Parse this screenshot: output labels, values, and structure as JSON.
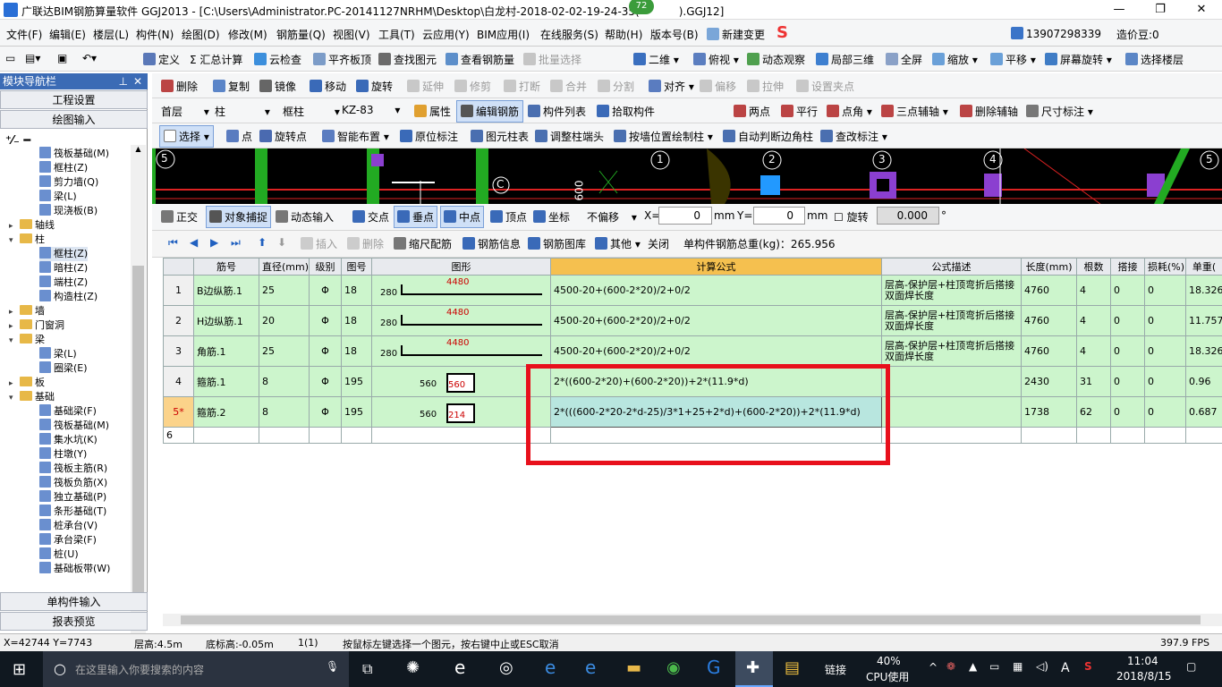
{
  "window": {
    "title": "广联达BIM钢筋算量软件 GGJ2013 - [C:\\Users\\Administrator.PC-20141127NRHM\\Desktop\\白龙村-2018-02-02-19-24-35(",
    "title_tail": ").GGJ12]",
    "badge": "72",
    "min": "—",
    "max": "❐",
    "close": "✕"
  },
  "menu": [
    "文件(F)",
    "编辑(E)",
    "楼层(L)",
    "构件(N)",
    "绘图(D)",
    "修改(M)",
    "钢筋量(Q)",
    "视图(V)",
    "工具(T)",
    "云应用(Y)",
    "BIM应用(I)",
    "在线服务(S)",
    "帮助(H)",
    "版本号(B)",
    "新建变更",
    "13907298339",
    "造价豆:0"
  ],
  "toolbar1": [
    "定义",
    "Σ 汇总计算",
    "云检查",
    "平齐板顶",
    "查找图元",
    "查看钢筋量",
    "批量选择",
    "二维",
    "俯视",
    "动态观察",
    "局部三维",
    "全屏",
    "缩放",
    "平移",
    "屏幕旋转",
    "选择楼层"
  ],
  "toolbar2": [
    "删除",
    "复制",
    "镜像",
    "移动",
    "旋转",
    "延伸",
    "修剪",
    "打断",
    "合并",
    "分割",
    "对齐",
    "偏移",
    "拉伸",
    "设置夹点"
  ],
  "toolbar3": {
    "floor": "首层",
    "type": "柱",
    "subtype": "框柱",
    "name": "KZ-83",
    "items": [
      "属性",
      "编辑钢筋",
      "构件列表",
      "拾取构件",
      "两点",
      "平行",
      "点角",
      "三点辅轴",
      "删除辅轴",
      "尺寸标注"
    ]
  },
  "toolbar4": [
    "选择",
    "点",
    "旋转点",
    "智能布置",
    "原位标注",
    "图元柱表",
    "调整柱端头",
    "按墙位置绘制柱",
    "自动判断边角柱",
    "查改标注"
  ],
  "snapbar": {
    "items": [
      "正交",
      "对象捕捉",
      "动态输入",
      "交点",
      "垂点",
      "中点",
      "顶点",
      "坐标"
    ],
    "offset_mode": "不偏移",
    "x_label": "X=",
    "x_val": "0",
    "y_label": "Y=",
    "y_val": "0",
    "unit": "mm",
    "rotate_label": "旋转",
    "rotate_val": "0.000",
    "deg": "°"
  },
  "rebarbar": {
    "items": [
      "插入",
      "删除",
      "缩尺配筋",
      "钢筋信息",
      "钢筋图库",
      "其他",
      "关闭"
    ],
    "total": "单构件钢筋总重(kg)：265.956"
  },
  "sidebar": {
    "header": "模块导航栏",
    "pin": "✕",
    "btn_top1": "工程设置",
    "btn_top2": "绘图输入",
    "btn_bot1": "单构件输入",
    "btn_bot2": "报表预览",
    "tree": [
      {
        "label": "筏板基础(M)",
        "kind": "leaf",
        "indent": 3
      },
      {
        "label": "框柱(Z)",
        "kind": "leaf",
        "indent": 3
      },
      {
        "label": "剪力墙(Q)",
        "kind": "leaf",
        "indent": 3
      },
      {
        "label": "梁(L)",
        "kind": "leaf",
        "indent": 3
      },
      {
        "label": "现浇板(B)",
        "kind": "leaf",
        "indent": 3
      },
      {
        "label": "轴线",
        "kind": "folder",
        "indent": 1,
        "exp": "⊞"
      },
      {
        "label": "柱",
        "kind": "folder",
        "indent": 1,
        "exp": "⊟"
      },
      {
        "label": "框柱(Z)",
        "kind": "leaf",
        "indent": 3
      },
      {
        "label": "暗柱(Z)",
        "kind": "leaf",
        "indent": 3
      },
      {
        "label": "端柱(Z)",
        "kind": "leaf",
        "indent": 3
      },
      {
        "label": "构造柱(Z)",
        "kind": "leaf",
        "indent": 3
      },
      {
        "label": "墙",
        "kind": "folder",
        "indent": 1,
        "exp": "⊞"
      },
      {
        "label": "门窗洞",
        "kind": "folder",
        "indent": 1,
        "exp": "⊞"
      },
      {
        "label": "梁",
        "kind": "folder",
        "indent": 1,
        "exp": "⊟"
      },
      {
        "label": "梁(L)",
        "kind": "leaf",
        "indent": 3
      },
      {
        "label": "圈梁(E)",
        "kind": "leaf",
        "indent": 3
      },
      {
        "label": "板",
        "kind": "folder",
        "indent": 1,
        "exp": "⊞"
      },
      {
        "label": "基础",
        "kind": "folder",
        "indent": 1,
        "exp": "⊟"
      },
      {
        "label": "基础梁(F)",
        "kind": "leaf",
        "indent": 3
      },
      {
        "label": "筏板基础(M)",
        "kind": "leaf",
        "indent": 3
      },
      {
        "label": "集水坑(K)",
        "kind": "leaf",
        "indent": 3
      },
      {
        "label": "柱墩(Y)",
        "kind": "leaf",
        "indent": 3
      },
      {
        "label": "筏板主筋(R)",
        "kind": "leaf",
        "indent": 3
      },
      {
        "label": "筏板负筋(X)",
        "kind": "leaf",
        "indent": 3
      },
      {
        "label": "独立基础(P)",
        "kind": "leaf",
        "indent": 3
      },
      {
        "label": "条形基础(T)",
        "kind": "leaf",
        "indent": 3
      },
      {
        "label": "桩承台(V)",
        "kind": "leaf",
        "indent": 3
      },
      {
        "label": "承台梁(F)",
        "kind": "leaf",
        "indent": 3
      },
      {
        "label": "桩(U)",
        "kind": "leaf",
        "indent": 3
      },
      {
        "label": "基础板带(W)",
        "kind": "leaf",
        "indent": 3
      }
    ]
  },
  "cad": {
    "axes": [
      "5",
      "1",
      "2",
      "3",
      "4",
      "5"
    ],
    "label_c": "C",
    "label_600": "600"
  },
  "table": {
    "headers": [
      "筋号",
      "直径(mm)",
      "级别",
      "图号",
      "图形",
      "计算公式",
      "公式描述",
      "长度(mm)",
      "根数",
      "搭接",
      "损耗(%)",
      "单重("
    ],
    "rows": [
      {
        "no": "1",
        "name": "B边纵筋.1",
        "dia": "25",
        "grade": "Φ",
        "fig": "18",
        "s_left": "280",
        "s_top": "4480",
        "s_right": "",
        "formula": "4500-20+(600-2*20)/2+0/2",
        "desc": "层高-保护层+柱顶弯折后搭接双面焊长度",
        "len": "4760",
        "count": "4",
        "lap": "0",
        "loss": "0",
        "unit_w": "18.326"
      },
      {
        "no": "2",
        "name": "H边纵筋.1",
        "dia": "20",
        "grade": "Φ",
        "fig": "18",
        "s_left": "280",
        "s_top": "4480",
        "s_right": "",
        "formula": "4500-20+(600-2*20)/2+0/2",
        "desc": "层高-保护层+柱顶弯折后搭接双面焊长度",
        "len": "4760",
        "count": "4",
        "lap": "0",
        "loss": "0",
        "unit_w": "11.757"
      },
      {
        "no": "3",
        "name": "角筋.1",
        "dia": "25",
        "grade": "Φ",
        "fig": "18",
        "s_left": "280",
        "s_top": "4480",
        "s_right": "",
        "formula": "4500-20+(600-2*20)/2+0/2",
        "desc": "层高-保护层+柱顶弯折后搭接双面焊长度",
        "len": "4760",
        "count": "4",
        "lap": "0",
        "loss": "0",
        "unit_w": "18.326"
      },
      {
        "no": "4",
        "name": "箍筋.1",
        "dia": "8",
        "grade": "Φ",
        "fig": "195",
        "s_left": "560",
        "s_top": "",
        "s_right": "560",
        "formula": "2*((600-2*20)+(600-2*20))+2*(11.9*d)",
        "desc": "",
        "len": "2430",
        "count": "31",
        "lap": "0",
        "loss": "0",
        "unit_w": "0.96"
      },
      {
        "no": "5*",
        "name": "箍筋.2",
        "dia": "8",
        "grade": "Φ",
        "fig": "195",
        "s_left": "560",
        "s_top": "",
        "s_right": "214",
        "formula": "2*(((600-2*20-2*d-25)/3*1+25+2*d)+(600-2*20))+2*(11.9*d)",
        "desc": "",
        "len": "1738",
        "count": "62",
        "lap": "0",
        "loss": "0",
        "unit_w": "0.687"
      },
      {
        "no": "6",
        "name": "",
        "dia": "",
        "grade": "",
        "fig": "",
        "s_left": "",
        "s_top": "",
        "s_right": "",
        "formula": "",
        "desc": "",
        "len": "",
        "count": "",
        "lap": "",
        "loss": "",
        "unit_w": ""
      }
    ]
  },
  "status": {
    "coords": "X=42744 Y=7743",
    "floor_h": "层高:4.5m",
    "bottom_h": "底标高:-0.05m",
    "count": "1(1)",
    "hint": "按鼠标左键选择一个图元，按右键中止或ESC取消",
    "fps": "397.9 FPS"
  },
  "taskbar": {
    "search": "在这里输入你要搜索的内容",
    "link": "链接",
    "cpu_pct": "40%",
    "cpu": "CPU使用",
    "ime": "A",
    "time": "11:04",
    "date": "2018/8/15"
  },
  "colors": {
    "row_green": "#ccf5cc",
    "header_hl": "#f5c04f",
    "red_box": "#e8101c"
  }
}
